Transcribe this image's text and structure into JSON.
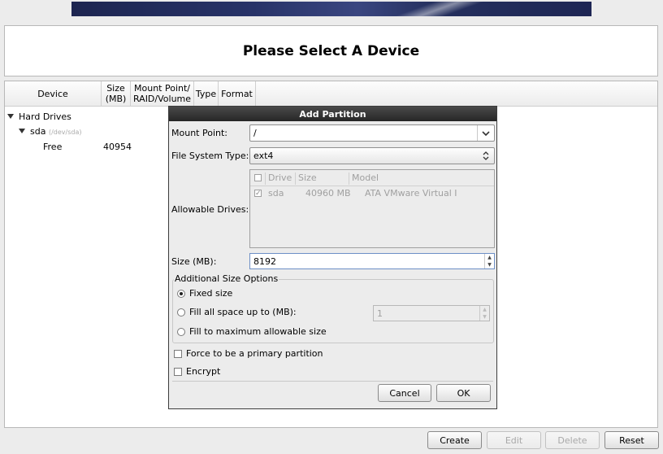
{
  "header": {
    "title": "Please Select A Device"
  },
  "device_table": {
    "columns": [
      "Device",
      "Size (MB)",
      "Mount Point/ RAID/Volume",
      "Type",
      "Format"
    ],
    "col_device": "Device",
    "col_size": "Size\n(MB)",
    "col_mount": "Mount Point/\nRAID/Volume",
    "col_type": "Type",
    "col_format": "Format",
    "tree": {
      "group": "Hard Drives",
      "disk": "sda",
      "disk_path": "(/dev/sda)",
      "free_label": "Free",
      "free_size": "40954"
    }
  },
  "dialog": {
    "title": "Add Partition",
    "mount_label": "Mount Point:",
    "mount_value": "/",
    "fstype_label": "File System Type:",
    "fstype_value": "ext4",
    "drives_label": "Allowable Drives:",
    "drives_columns": {
      "drive": "Drive",
      "size": "Size",
      "model": "Model"
    },
    "drives": [
      {
        "checked": true,
        "drive": "sda",
        "size": "40960 MB",
        "model": "ATA VMware Virtual I"
      }
    ],
    "size_label": "Size (MB):",
    "size_value": "8192",
    "options_title": "Additional Size Options",
    "opt_fixed": "Fixed size",
    "opt_fill_upto": "Fill all space up to (MB):",
    "fill_upto_value": "1",
    "opt_fill_max": "Fill to maximum allowable size",
    "selected_option": "fixed",
    "primary_label": "Force to be a primary partition",
    "primary_checked": false,
    "encrypt_label": "Encrypt",
    "encrypt_checked": false,
    "cancel": "Cancel",
    "ok": "OK"
  },
  "footer": {
    "create": "Create",
    "edit": "Edit",
    "delete": "Delete",
    "reset": "Reset"
  }
}
